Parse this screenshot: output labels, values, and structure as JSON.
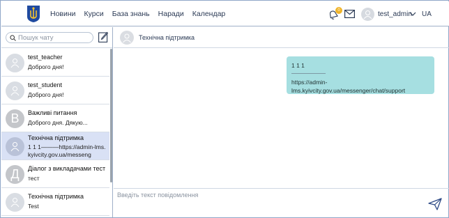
{
  "nav": {
    "items": [
      "Новини",
      "Курси",
      "База знань",
      "Наради",
      "Календар"
    ]
  },
  "header": {
    "notification_count": "0",
    "user_name": "test_admin",
    "language": "UA"
  },
  "sidebar": {
    "search_placeholder": "Пошук чату",
    "chats": [
      {
        "avatar": "",
        "name": "test_teacher",
        "preview": "Доброго дня!"
      },
      {
        "avatar": "",
        "name": "test_student",
        "preview": "Доброго дня!"
      },
      {
        "avatar": "В",
        "name": "Важливі питання",
        "preview": "Доброго дня. Дякую..."
      },
      {
        "avatar": "",
        "name": "Технічна підтримка",
        "preview": "1 1 1———https://admin-lms.kyivcity.gov.ua/messeng"
      },
      {
        "avatar": "Д",
        "name": "Діалог з викладачами тест",
        "preview": "тест"
      },
      {
        "avatar": "",
        "name": "Технічна підтримка",
        "preview": "Test"
      }
    ]
  },
  "chat": {
    "title": "Технічна підтримка",
    "message": {
      "line1": "1 1 1",
      "line2": "———————",
      "line3": "https://admin-lms.kyivcity.gov.ua/messenger/chat/support"
    },
    "composer_placeholder": "Введіть текст повідомлення"
  },
  "colors": {
    "bubble": "#a6dfe1",
    "active_chat": "#d9e1f5",
    "badge": "#f0b429",
    "border": "#9fb0c8"
  }
}
